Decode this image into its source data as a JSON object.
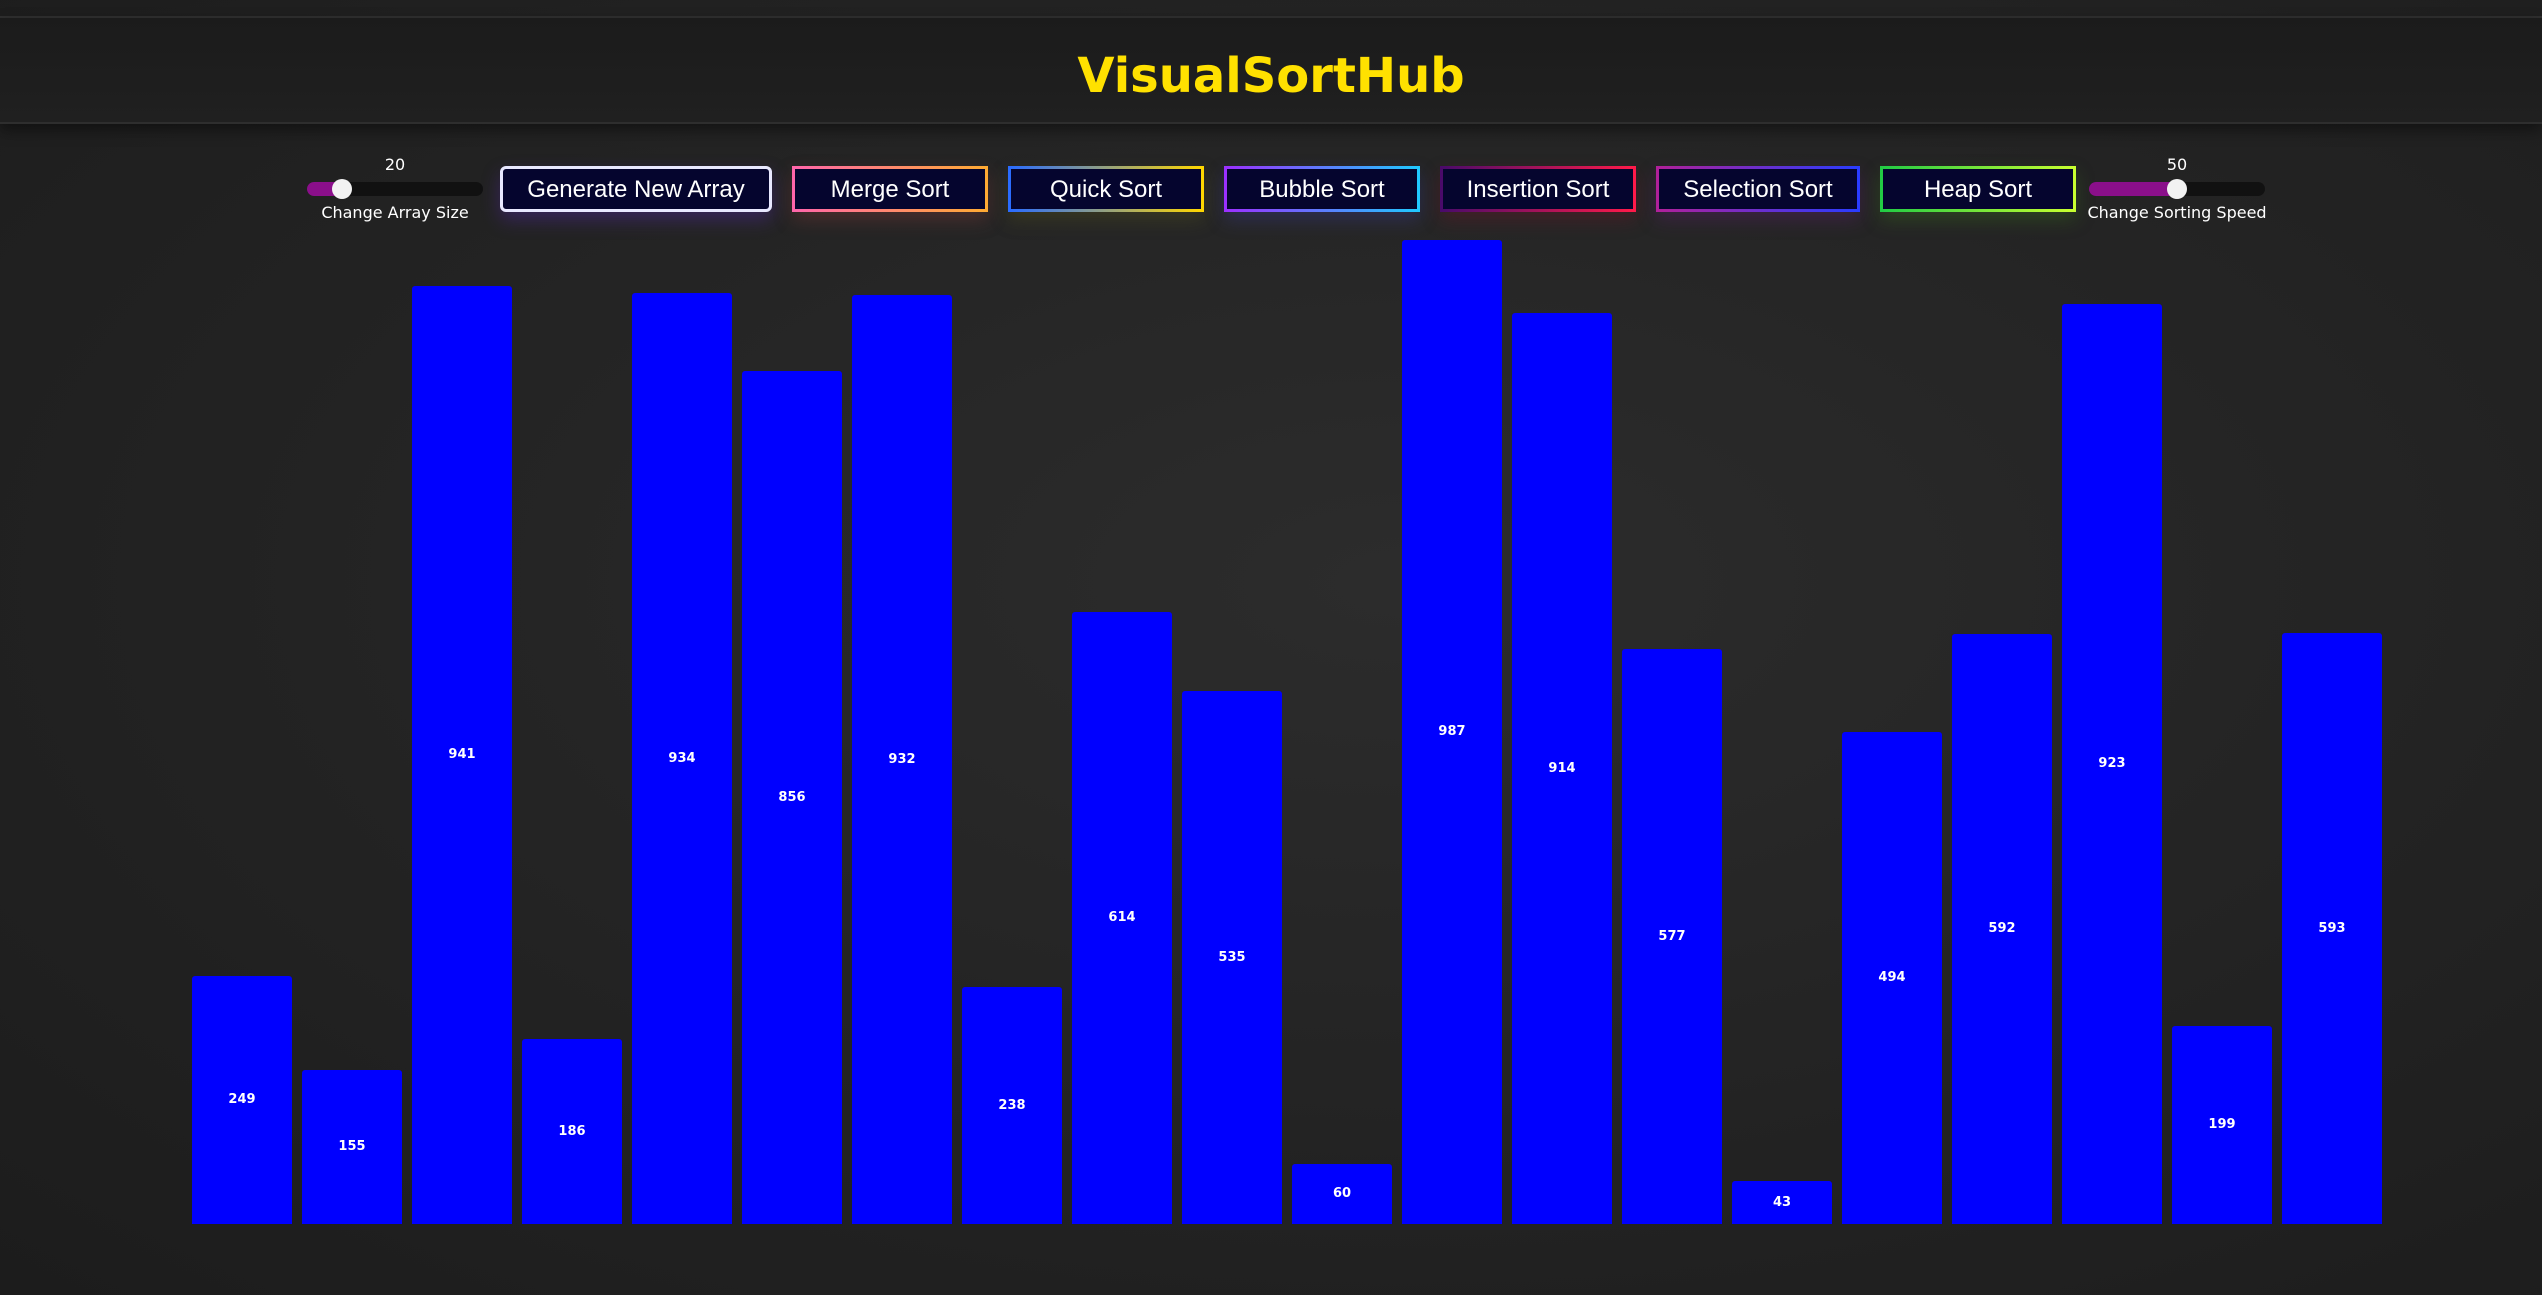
{
  "header": {
    "title": "VisualSortHub"
  },
  "controls": {
    "array_size": {
      "value": "20",
      "caption": "Change Array Size",
      "fraction": 0.2
    },
    "sorting_speed": {
      "value": "50",
      "caption": "Change Sorting Speed",
      "fraction": 0.5
    },
    "buttons": {
      "generate": "Generate New Array",
      "merge": "Merge Sort",
      "quick": "Quick Sort",
      "bubble": "Bubble Sort",
      "insertion": "Insertion Sort",
      "selection": "Selection Sort",
      "heap": "Heap Sort"
    }
  },
  "colors": {
    "title": "#ffe100",
    "bar": "#0000ff",
    "button_bg": "#05052e"
  },
  "array": {
    "values": [
      249,
      155,
      941,
      186,
      934,
      856,
      932,
      238,
      614,
      535,
      60,
      987,
      914,
      577,
      43,
      494,
      592,
      923,
      199,
      593
    ]
  }
}
